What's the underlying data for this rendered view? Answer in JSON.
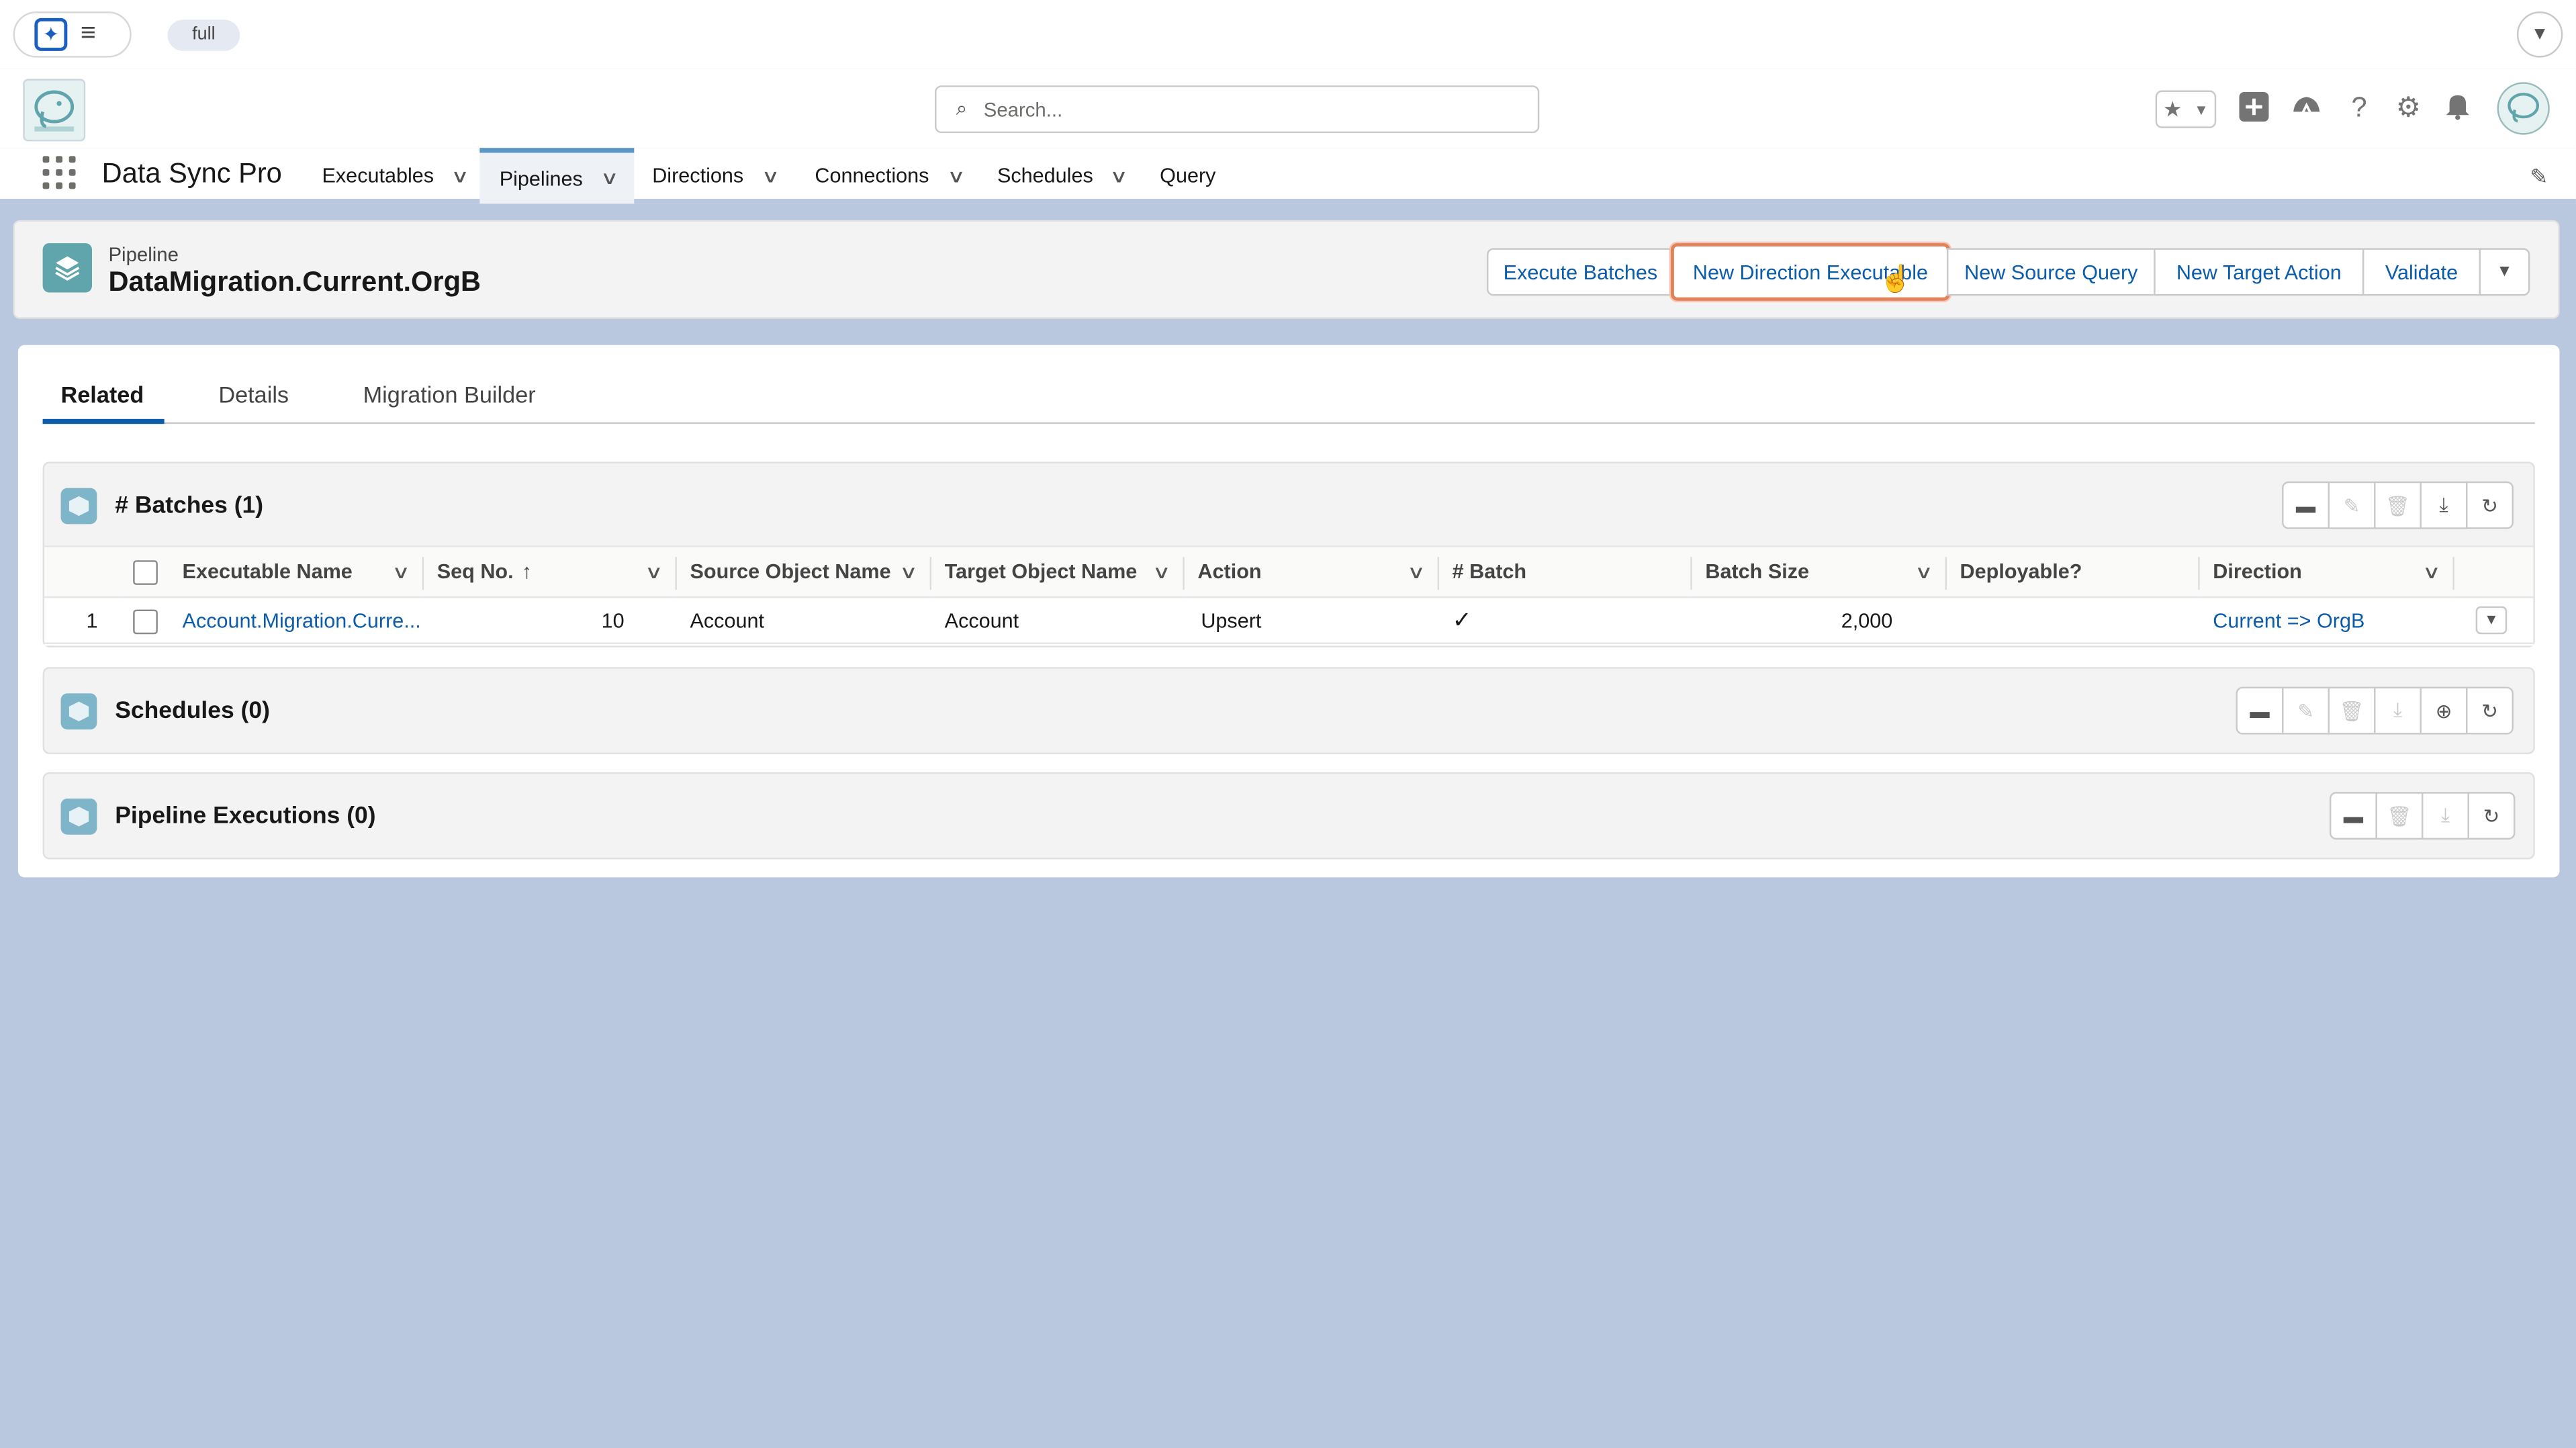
{
  "topbar": {
    "env_label": "full",
    "spark_icon": "✦",
    "menu_icon": "≡",
    "caret": "▼"
  },
  "header": {
    "search_placeholder": "Search...",
    "icons": [
      "favorites-star-icon",
      "favorites-list-icon",
      "global-add-icon",
      "trailhead-icon",
      "help-icon",
      "setup-gear-icon",
      "notifications-bell-icon",
      "user-avatar"
    ]
  },
  "nav": {
    "app_name": "Data Sync Pro",
    "items": [
      {
        "label": "Executables"
      },
      {
        "label": "Pipelines"
      },
      {
        "label": "Directions"
      },
      {
        "label": "Connections"
      },
      {
        "label": "Schedules"
      },
      {
        "label": "Query"
      }
    ],
    "active": "Pipelines"
  },
  "record": {
    "type": "Pipeline",
    "name": "DataMigration.Current.OrgB",
    "actions": [
      "Execute Batches",
      "New Direction Executable",
      "New Source Query",
      "New Target Action",
      "Validate"
    ],
    "highlighted_action": "New Direction Executable"
  },
  "tabs": [
    {
      "label": "Related"
    },
    {
      "label": "Details"
    },
    {
      "label": "Migration Builder"
    }
  ],
  "active_tab": "Related",
  "batches": {
    "title": "# Batches (1)",
    "columns": [
      "Executable Name",
      "Seq No.",
      "Source Object Name",
      "Target Object Name",
      "Action",
      "# Batch",
      "Batch Size",
      "Deployable?",
      "Direction"
    ],
    "sort_indicator": "↑",
    "rows": [
      {
        "row_number": "1",
        "executable_name": "Account.Migration.Curre...",
        "seq_no": "10",
        "source_object": "Account",
        "target_object": "Account",
        "action": "Upsert",
        "batch": "✓",
        "batch_size": "2,000",
        "deployable": "",
        "direction": "Current => OrgB"
      }
    ]
  },
  "schedules": {
    "title": "Schedules (0)"
  },
  "pipeline_executions": {
    "title": "Pipeline Executions (0)"
  },
  "colors": {
    "page_bg": "#bac8df",
    "link": "#0b5cab",
    "highlight_border": "#e0825c",
    "record_icon": "#5fa5ab",
    "related_icon": "#7fb5c8"
  }
}
